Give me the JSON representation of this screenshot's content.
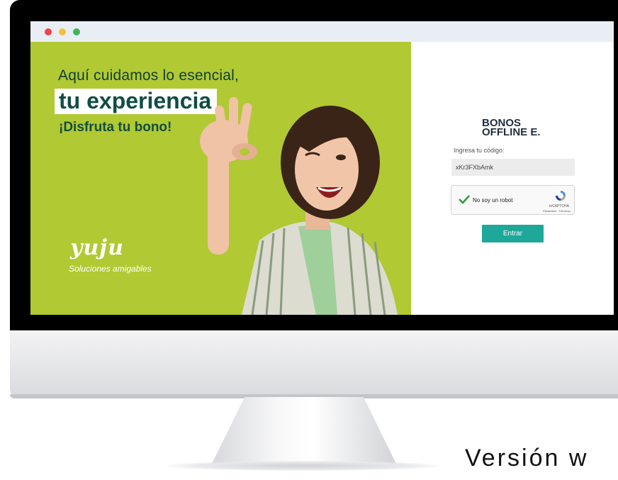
{
  "hero": {
    "tagline_line1": "Aquí cuidamos lo esencial,",
    "tagline_line2": "tu experiencia",
    "tagline_line3": "¡Disfruta tu bono!",
    "brand_name": "yuju",
    "brand_slogan": "Soluciones amigables",
    "background_color": "#b1c932"
  },
  "login": {
    "title": "BONOS\nOFFLINE E.",
    "code_label": "Ingresa tu código:",
    "code_value": "xKr3FXbAmk",
    "captcha": {
      "label": "No soy un robot",
      "brand": "reCAPTCHA",
      "links": "Privacidad - Términos"
    },
    "submit_label": "Entrar",
    "accent_color": "#1ea89a"
  },
  "caption": "Versión w",
  "window_controls": [
    "close-dot",
    "minimize-dot",
    "maximize-dot"
  ]
}
